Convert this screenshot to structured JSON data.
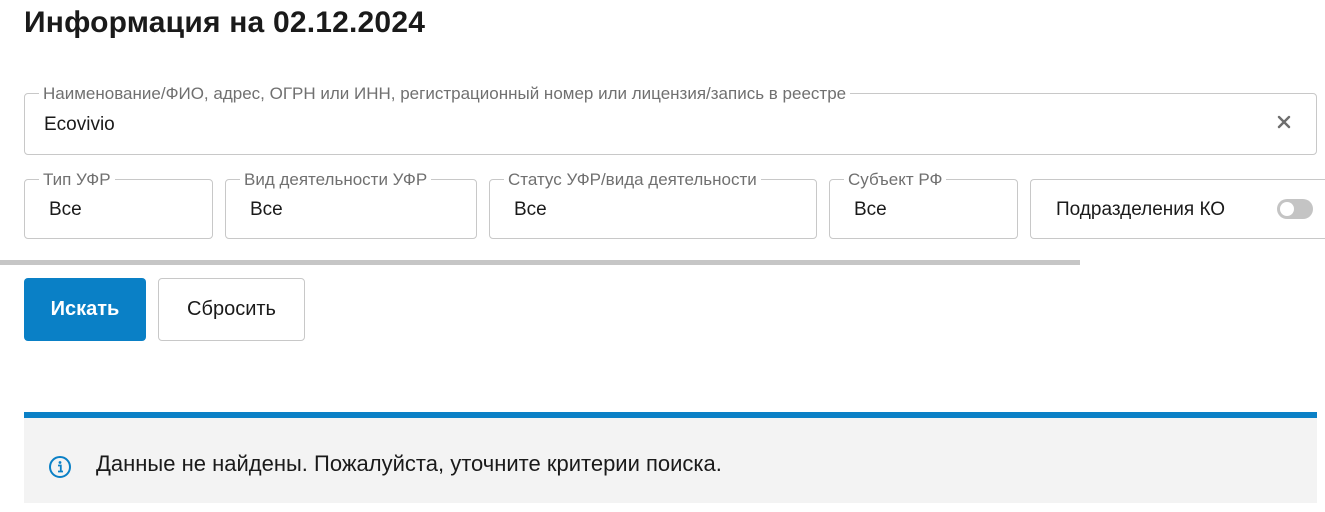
{
  "page": {
    "title": "Информация на 02.12.2024"
  },
  "search": {
    "label": "Наименование/ФИО, адрес, ОГРН или ИНН, регистрационный номер или лицензия/запись в реестре",
    "value": "Ecovivio",
    "clear_icon": "close-icon"
  },
  "filters": [
    {
      "label": "Тип УФР",
      "value": "Все"
    },
    {
      "label": "Вид деятельности УФР",
      "value": "Все"
    },
    {
      "label": "Статус УФР/вида деятельности",
      "value": "Все"
    },
    {
      "label": "Субъект РФ",
      "value": "Все"
    }
  ],
  "toggle": {
    "label": "Подразделения КО",
    "state": "off"
  },
  "buttons": {
    "search_label": "Искать",
    "reset_label": "Сбросить"
  },
  "notice": {
    "icon": "info-icon",
    "text": "Данные не найдены. Пожалуйста, уточните критерии поиска."
  },
  "colors": {
    "accent": "#0a80c6",
    "notice_bg": "#f3f3f3",
    "border": "#c8c8c8",
    "label": "#707070"
  }
}
